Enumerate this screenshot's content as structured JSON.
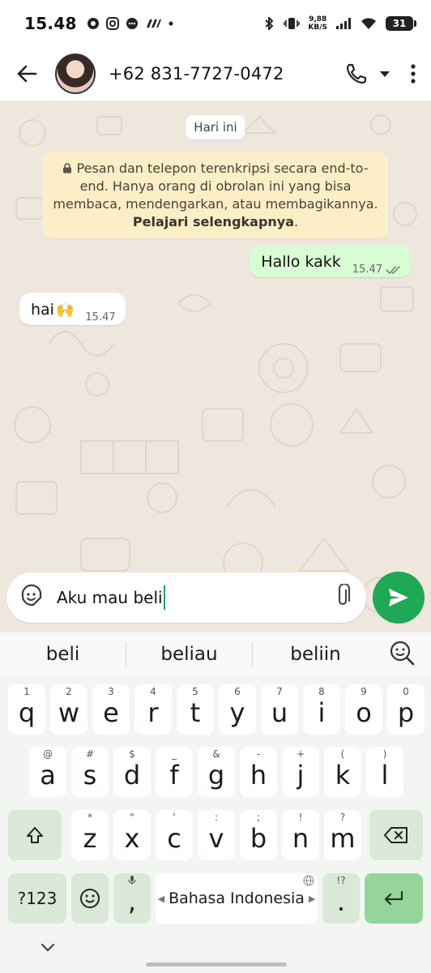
{
  "status_bar": {
    "time": "15.48",
    "net_speed_value": "9,88",
    "net_speed_unit": "KB/S",
    "battery": "31"
  },
  "header": {
    "contact": "+62 831-7727-0472"
  },
  "chat": {
    "date_chip": "Hari ini",
    "encryption_text": "Pesan dan telepon terenkripsi secara end-to-end. Hanya orang di obrolan ini yang bisa membaca, mendengarkan, atau membagikannya. ",
    "encryption_link": "Pelajari selengkapnya",
    "encryption_end": ".",
    "messages": [
      {
        "direction": "out",
        "text": "Hallo kakk",
        "time": "15.47"
      },
      {
        "direction": "in",
        "text": "hai",
        "emoji": "🙌",
        "time": "15.47"
      }
    ]
  },
  "composer": {
    "text": "Aku mau beli"
  },
  "keyboard": {
    "suggestions": [
      "beli",
      "beliau",
      "beliin"
    ],
    "row1": [
      {
        "k": "q",
        "h": "1"
      },
      {
        "k": "w",
        "h": "2"
      },
      {
        "k": "e",
        "h": "3"
      },
      {
        "k": "r",
        "h": "4"
      },
      {
        "k": "t",
        "h": "5"
      },
      {
        "k": "y",
        "h": "6"
      },
      {
        "k": "u",
        "h": "7"
      },
      {
        "k": "i",
        "h": "8"
      },
      {
        "k": "o",
        "h": "9"
      },
      {
        "k": "p",
        "h": "0"
      }
    ],
    "row2": [
      {
        "k": "a",
        "h": "@"
      },
      {
        "k": "s",
        "h": "#"
      },
      {
        "k": "d",
        "h": "$"
      },
      {
        "k": "f",
        "h": "_"
      },
      {
        "k": "g",
        "h": "&"
      },
      {
        "k": "h",
        "h": "-"
      },
      {
        "k": "j",
        "h": "+"
      },
      {
        "k": "k",
        "h": "("
      },
      {
        "k": "l",
        "h": ")"
      }
    ],
    "row3": [
      {
        "k": "z",
        "h": "*"
      },
      {
        "k": "x",
        "h": "\""
      },
      {
        "k": "c",
        "h": "'"
      },
      {
        "k": "v",
        "h": ":"
      },
      {
        "k": "b",
        "h": ";"
      },
      {
        "k": "n",
        "h": "!"
      },
      {
        "k": "m",
        "h": "?"
      }
    ],
    "symbols_label": "?123",
    "comma": ",",
    "period": ".",
    "period_hint": "!?",
    "space_label": "Bahasa Indonesia"
  }
}
